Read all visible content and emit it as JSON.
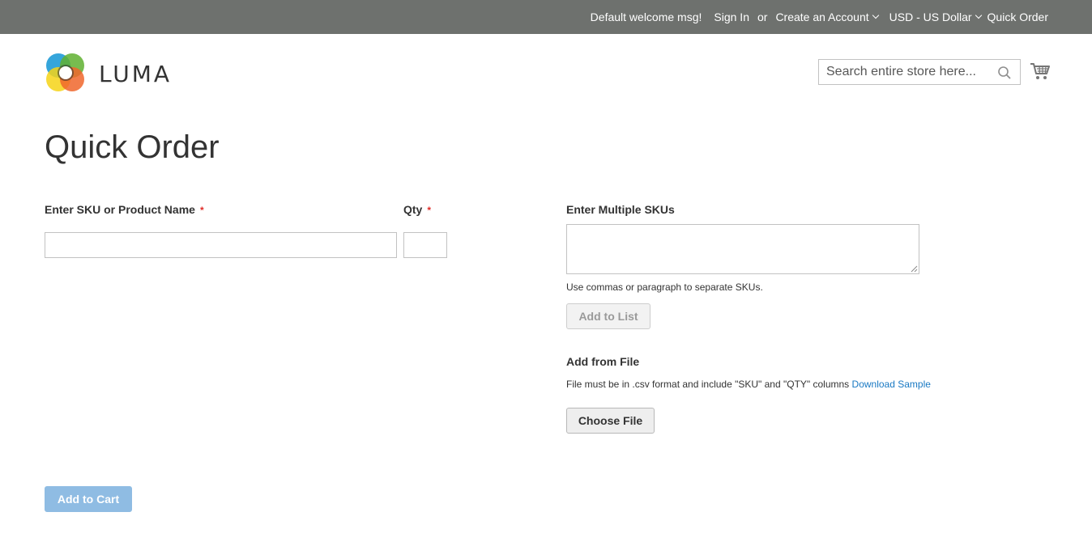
{
  "topbar": {
    "welcome": "Default welcome msg!",
    "sign_in": "Sign In",
    "or": "or",
    "create_account": "Create an Account",
    "currency": "USD - US Dollar",
    "quick_order": "Quick Order"
  },
  "header": {
    "logo_text": "LUMA",
    "search_placeholder": "Search entire store here...",
    "search_value": ""
  },
  "page": {
    "title": "Quick Order"
  },
  "form": {
    "sku_label": "Enter SKU or Product Name",
    "qty_label": "Qty",
    "required_mark": "*",
    "sku_value": "",
    "qty_value": "",
    "multi_label": "Enter Multiple SKUs",
    "multi_value": "",
    "multi_note": "Use commas or paragraph to separate SKUs.",
    "add_to_list": "Add to List",
    "file_label": "Add from File",
    "file_note": "File must be in .csv format and include \"SKU\" and \"QTY\" columns",
    "download_sample": "Download Sample",
    "choose_file": "Choose File",
    "add_to_cart": "Add to Cart"
  },
  "icons": {
    "search": "search-icon",
    "cart": "cart-icon",
    "chevron": "chevron-down-icon"
  },
  "colors": {
    "topbar_bg": "#6e716e",
    "link": "#1979c3",
    "required": "#e02b27",
    "primary_disabled": "#8fbce3"
  }
}
